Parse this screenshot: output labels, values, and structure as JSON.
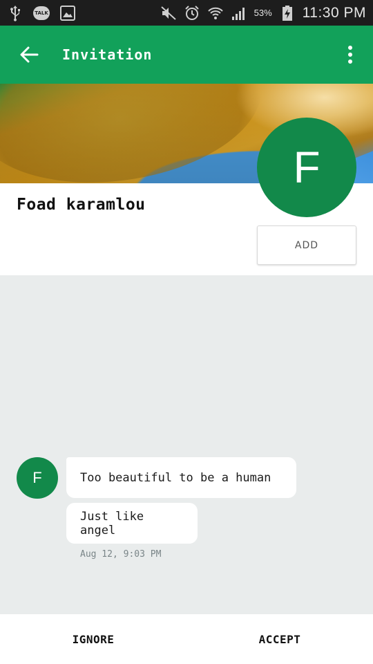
{
  "status_bar": {
    "left_icons": [
      "usb-icon",
      "talk-icon",
      "gallery-icon"
    ],
    "talk_label": "TALK",
    "right_icons": [
      "mute-icon",
      "alarm-icon",
      "wifi-icon",
      "signal-icon",
      "battery-icon"
    ],
    "battery": "53%",
    "time": "11:30 PM"
  },
  "app_bar": {
    "title": "Invitation",
    "back_icon": "arrow-back-icon",
    "menu_icon": "more-vert-icon",
    "color": "#12a15a"
  },
  "profile": {
    "name": "Foad karamlou",
    "avatar_letter": "F",
    "add_label": "ADD",
    "avatar_color": "#12894a"
  },
  "chat": {
    "avatar_letter": "F",
    "messages": [
      {
        "text": "Too beautiful to be a human"
      },
      {
        "text": "Just like angel"
      }
    ],
    "timestamp": "Aug 12, 9:03 PM"
  },
  "actions": {
    "ignore_label": "IGNORE",
    "accept_label": "ACCEPT"
  }
}
